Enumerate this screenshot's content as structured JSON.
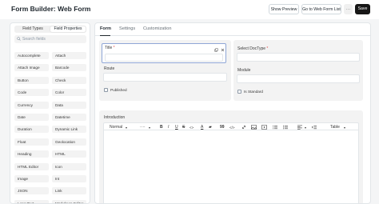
{
  "header": {
    "title": "Form Builder: Web Form",
    "show_preview": "Show Preview",
    "go_to_list": "Go to Web Form List",
    "more": "···",
    "save": "Save"
  },
  "sidebar": {
    "tabs": [
      "Field Types",
      "Field Properties"
    ],
    "active_tab": "Field Properties",
    "search_placeholder": "Search fields",
    "fields": [
      "Autocomplete",
      "Attach",
      "Attach Image",
      "Barcode",
      "Button",
      "Check",
      "Code",
      "Color",
      "Currency",
      "Data",
      "Date",
      "Datetime",
      "Duration",
      "Dynamic Link",
      "Float",
      "Geolocation",
      "Heading",
      "HTML",
      "HTML Editor",
      "Icon",
      "Image",
      "Int",
      "JSON",
      "Link",
      "Long Text",
      "Markdown Editor"
    ]
  },
  "main": {
    "tabs": [
      "Form",
      "Settings",
      "Customization"
    ],
    "active_tab": "Form",
    "title_label": "Title",
    "title_required": "*",
    "title_value": "",
    "route_label": "Route",
    "published_label": "Published",
    "doctype_label": "Select DocType",
    "doctype_required": "*",
    "module_label": "Module",
    "is_standard_label": "Is Standard",
    "introduction_label": "Introduction",
    "toolbar": {
      "style": "Normal",
      "size": "····",
      "bold": "B",
      "italic": "I",
      "underline": "U",
      "strike": "S",
      "code": "<>",
      "color": "A",
      "quote": "99",
      "link": "⧉",
      "table": "Table"
    }
  },
  "colors": {
    "accent_dark": "#171717",
    "focus_border": "#8fa6d6",
    "required": "#e24c4c"
  }
}
